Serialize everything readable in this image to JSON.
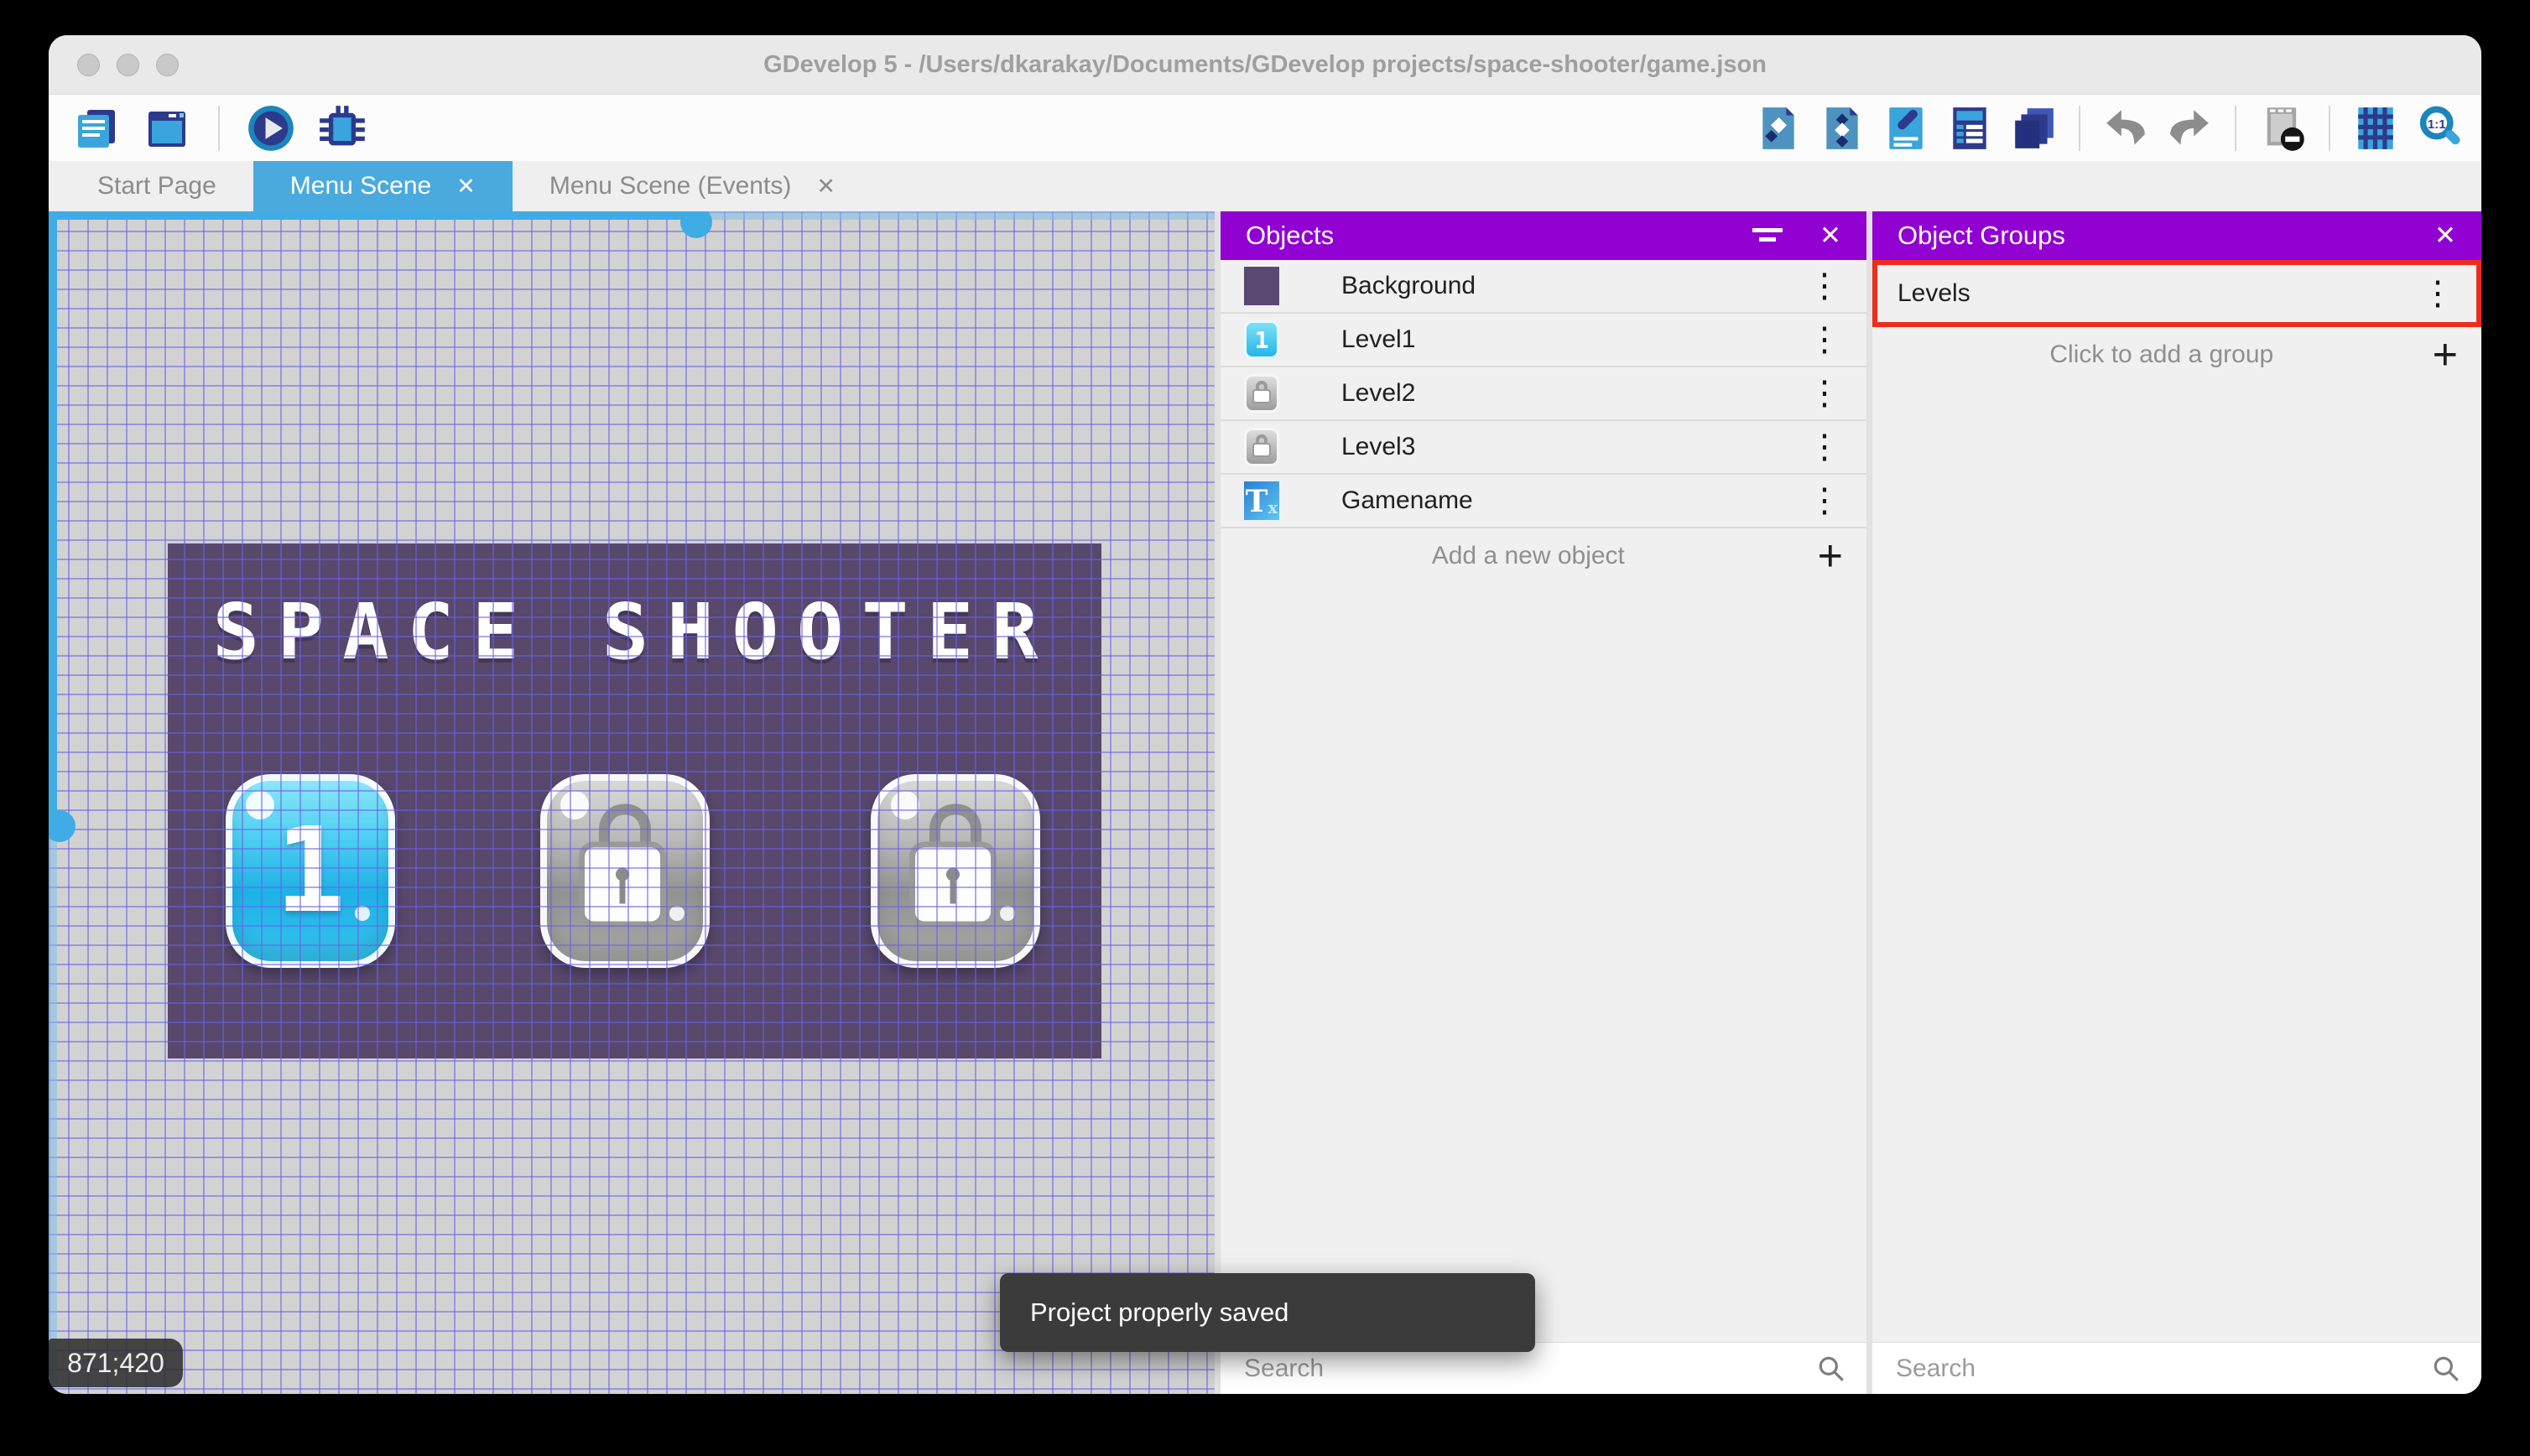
{
  "window": {
    "title": "GDevelop 5 - /Users/dkarakay/Documents/GDevelop projects/space-shooter/game.json"
  },
  "titlebar_icons": [
    "close",
    "minimize",
    "zoom"
  ],
  "toolbar": {
    "left_icons": [
      "project-manager",
      "scene-preview-window",
      "play-preview",
      "debug"
    ],
    "right_icons": [
      "objects-editor",
      "object-groups-editor",
      "properties",
      "instances-list",
      "layers",
      "undo",
      "redo",
      "toggle-mask",
      "toggle-grid",
      "zoom-1-1"
    ]
  },
  "tabs": [
    {
      "label": "Start Page",
      "active": false,
      "closable": false
    },
    {
      "label": "Menu Scene",
      "active": true,
      "closable": true
    },
    {
      "label": "Menu Scene (Events)",
      "active": false,
      "closable": true
    }
  ],
  "icons": {
    "close_tab": "✕",
    "kebab": "⋮",
    "plus": "+",
    "zoom_1_1": "1:1",
    "text_object_T": "T",
    "text_object_x": "x"
  },
  "scene": {
    "title_text": "SPACE SHOOTER",
    "buttons": [
      {
        "label": "1",
        "state": "unlocked"
      },
      {
        "label": "",
        "state": "locked"
      },
      {
        "label": "",
        "state": "locked"
      }
    ],
    "coordinates": "871;420"
  },
  "toast": {
    "message": "Project properly saved"
  },
  "objects_panel": {
    "title": "Objects",
    "items": [
      {
        "name": "Background",
        "thumb": "purple-square"
      },
      {
        "name": "Level1",
        "thumb": "cyan-button",
        "thumb_label": "1"
      },
      {
        "name": "Level2",
        "thumb": "locked-button"
      },
      {
        "name": "Level3",
        "thumb": "locked-button"
      },
      {
        "name": "Gamename",
        "thumb": "text-object"
      }
    ],
    "add_label": "Add a new object",
    "search_placeholder": "Search"
  },
  "object_groups_panel": {
    "title": "Object Groups",
    "items": [
      {
        "name": "Levels"
      }
    ],
    "add_label": "Click to add a group",
    "search_placeholder": "Search"
  },
  "colors": {
    "accent_purple": "#9001d2",
    "tab_active_blue": "#4aaade",
    "annotation_red": "#ec2d1e",
    "scene_background": "#57486c",
    "grid_line": "#6c60e8",
    "button_cyan": "#2cbfec",
    "button_gray": "#a0a09e",
    "toolbar_navy": "#2d3a8c",
    "toolbar_blue": "#3aa4dc"
  }
}
